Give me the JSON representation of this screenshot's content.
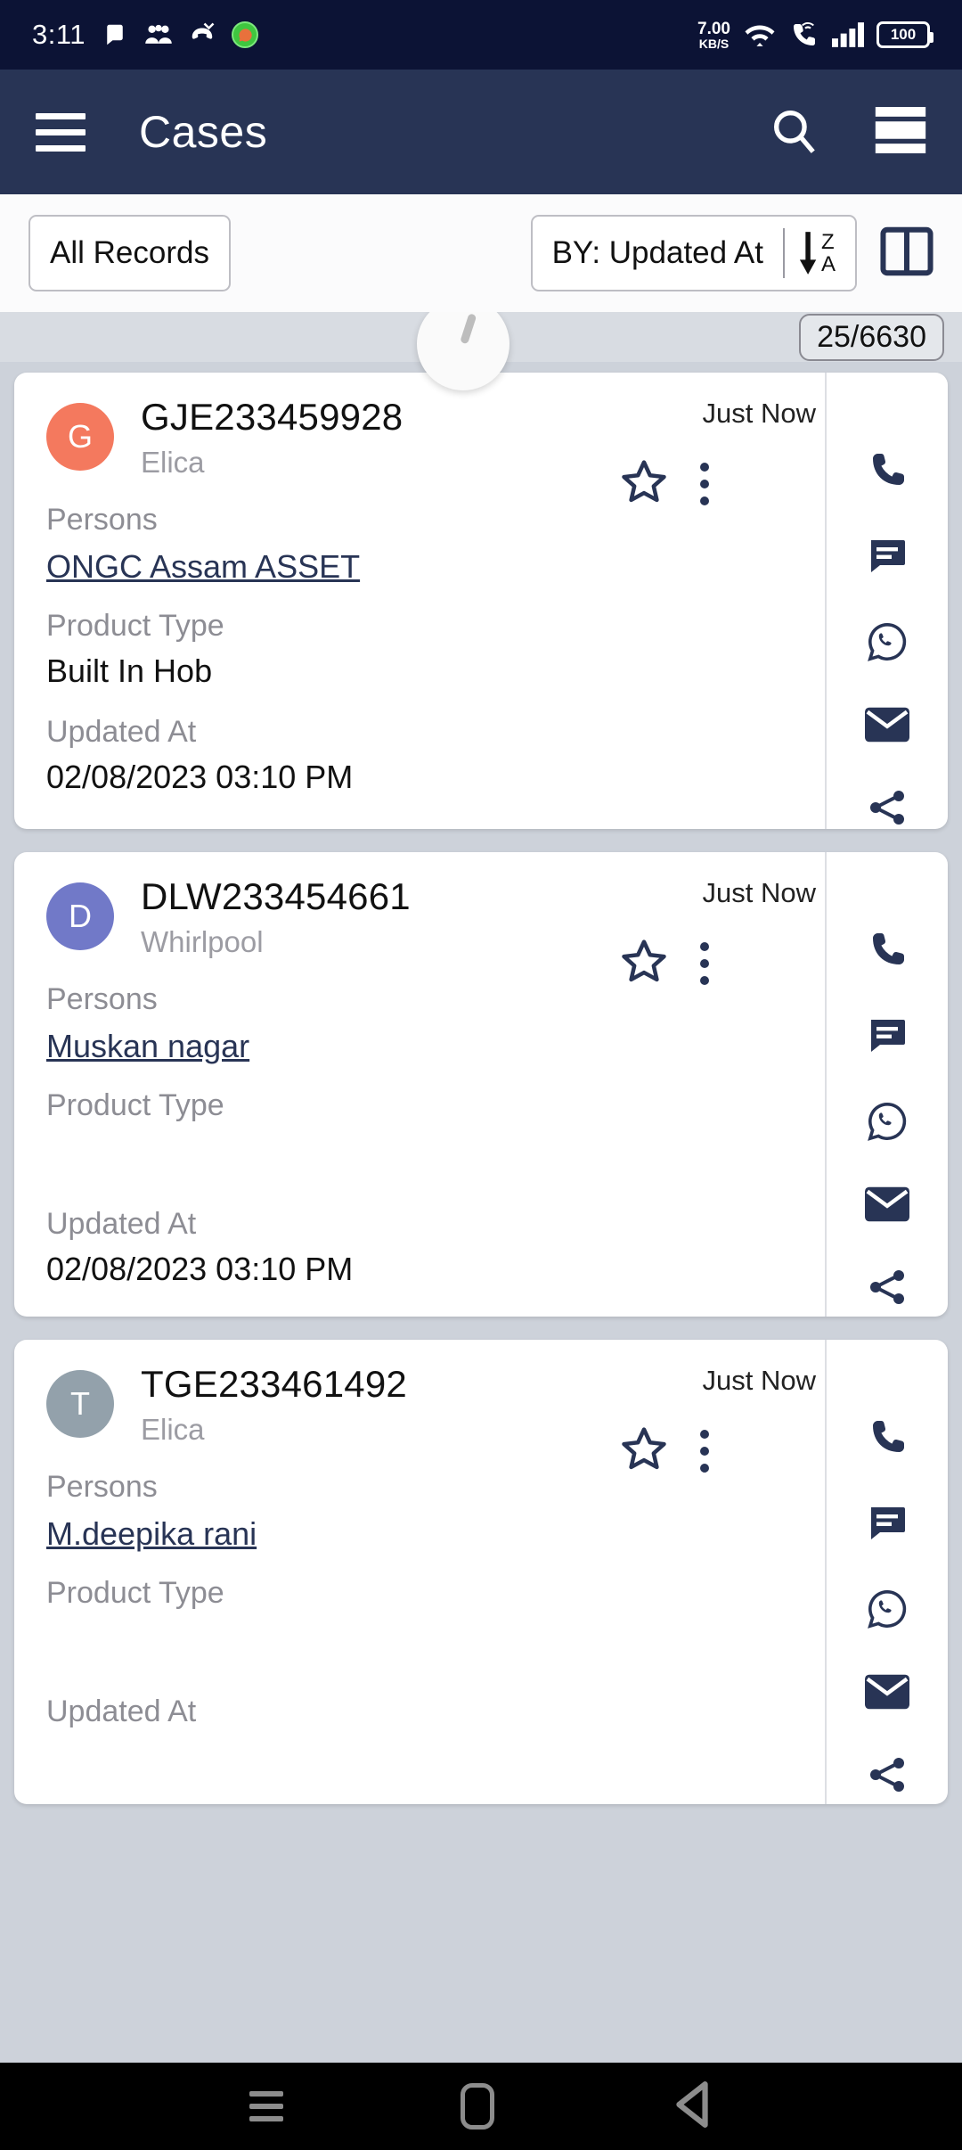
{
  "status_bar": {
    "time": "3:11",
    "network_speed_value": "7.00",
    "network_speed_unit": "KB/S",
    "battery_level": "100",
    "icons": [
      "chat-bubble-icon",
      "people-icon",
      "missed-call-icon",
      "whatsapp-badge-icon",
      "wifi-icon",
      "wifi-calling-icon",
      "signal-bars-icon",
      "battery-icon"
    ]
  },
  "app_bar": {
    "title": "Cases",
    "menu_icon": "hamburger-menu-icon",
    "search_icon": "search-icon",
    "view_icon": "list-view-icon"
  },
  "filter_bar": {
    "records_filter": "All Records",
    "sort_label": "BY: Updated At",
    "sort_order_letters": [
      "Z",
      "A"
    ],
    "sort_icon": "sort-descending-icon",
    "layout_icon": "split-view-icon"
  },
  "list": {
    "count_badge": "25/6630",
    "refresh_indicator": "pull-to-refresh-spinner",
    "field_labels": {
      "persons": "Persons",
      "product_type": "Product Type",
      "updated_at": "Updated At"
    },
    "action_icons": [
      "phone-icon",
      "message-icon",
      "whatsapp-icon",
      "email-icon",
      "share-icon"
    ],
    "cards": [
      {
        "avatar_letter": "G",
        "avatar_color": "#F4795E",
        "case_id": "GJE233459928",
        "brand": "Elica",
        "person": "ONGC Assam ASSET",
        "product_type": "Built In Hob",
        "updated_at": "02/08/2023 03:10 PM",
        "timestamp": "Just Now",
        "starred": false
      },
      {
        "avatar_letter": "D",
        "avatar_color": "#7179C8",
        "case_id": "DLW233454661",
        "brand": "Whirlpool",
        "person": "Muskan nagar",
        "product_type": "",
        "updated_at": "02/08/2023 03:10 PM",
        "timestamp": "Just Now",
        "starred": false
      },
      {
        "avatar_letter": "T",
        "avatar_color": "#93A1AB",
        "case_id": "TGE233461492",
        "brand": "Elica",
        "person": "M.deepika rani",
        "product_type": "",
        "updated_at": "",
        "timestamp": "Just Now",
        "starred": false
      }
    ]
  },
  "nav_bar": {
    "recent_icon": "recent-apps-icon",
    "home_icon": "home-icon",
    "back_icon": "back-icon"
  },
  "colors": {
    "status_bar_bg": "#0C1335",
    "app_bar_bg": "#283455",
    "page_bg": "#CDD2DA",
    "accent": "#283455"
  }
}
